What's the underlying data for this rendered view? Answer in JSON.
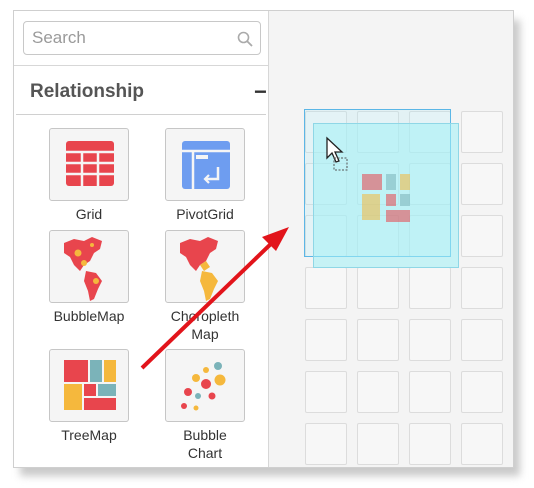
{
  "search": {
    "placeholder": "Search"
  },
  "section": {
    "title": "Relationship",
    "collapse_symbol": "−"
  },
  "widgets": [
    {
      "label": "Grid",
      "icon": "grid-icon"
    },
    {
      "label": "PivotGrid",
      "icon": "pivot-grid-icon"
    },
    {
      "label": "BubbleMap",
      "icon": "bubble-map-icon"
    },
    {
      "label_line1": "Choropleth",
      "label_line2": "Map",
      "icon": "choropleth-map-icon"
    },
    {
      "label": "TreeMap",
      "icon": "treemap-icon"
    },
    {
      "label_line1": "Bubble",
      "label_line2": "Chart",
      "icon": "bubble-chart-icon"
    }
  ],
  "colors": {
    "grid_red": "#e8454d",
    "pivot_blue": "#6e9df0",
    "map_red": "#e8454d",
    "map_yellow": "#f5b83d",
    "treemap_red": "#e8454d",
    "treemap_teal": "#7bb3b9",
    "treemap_yellow": "#f5b83d",
    "arrow_red": "#e2141b",
    "drop_blue": "#5bb6e6"
  }
}
